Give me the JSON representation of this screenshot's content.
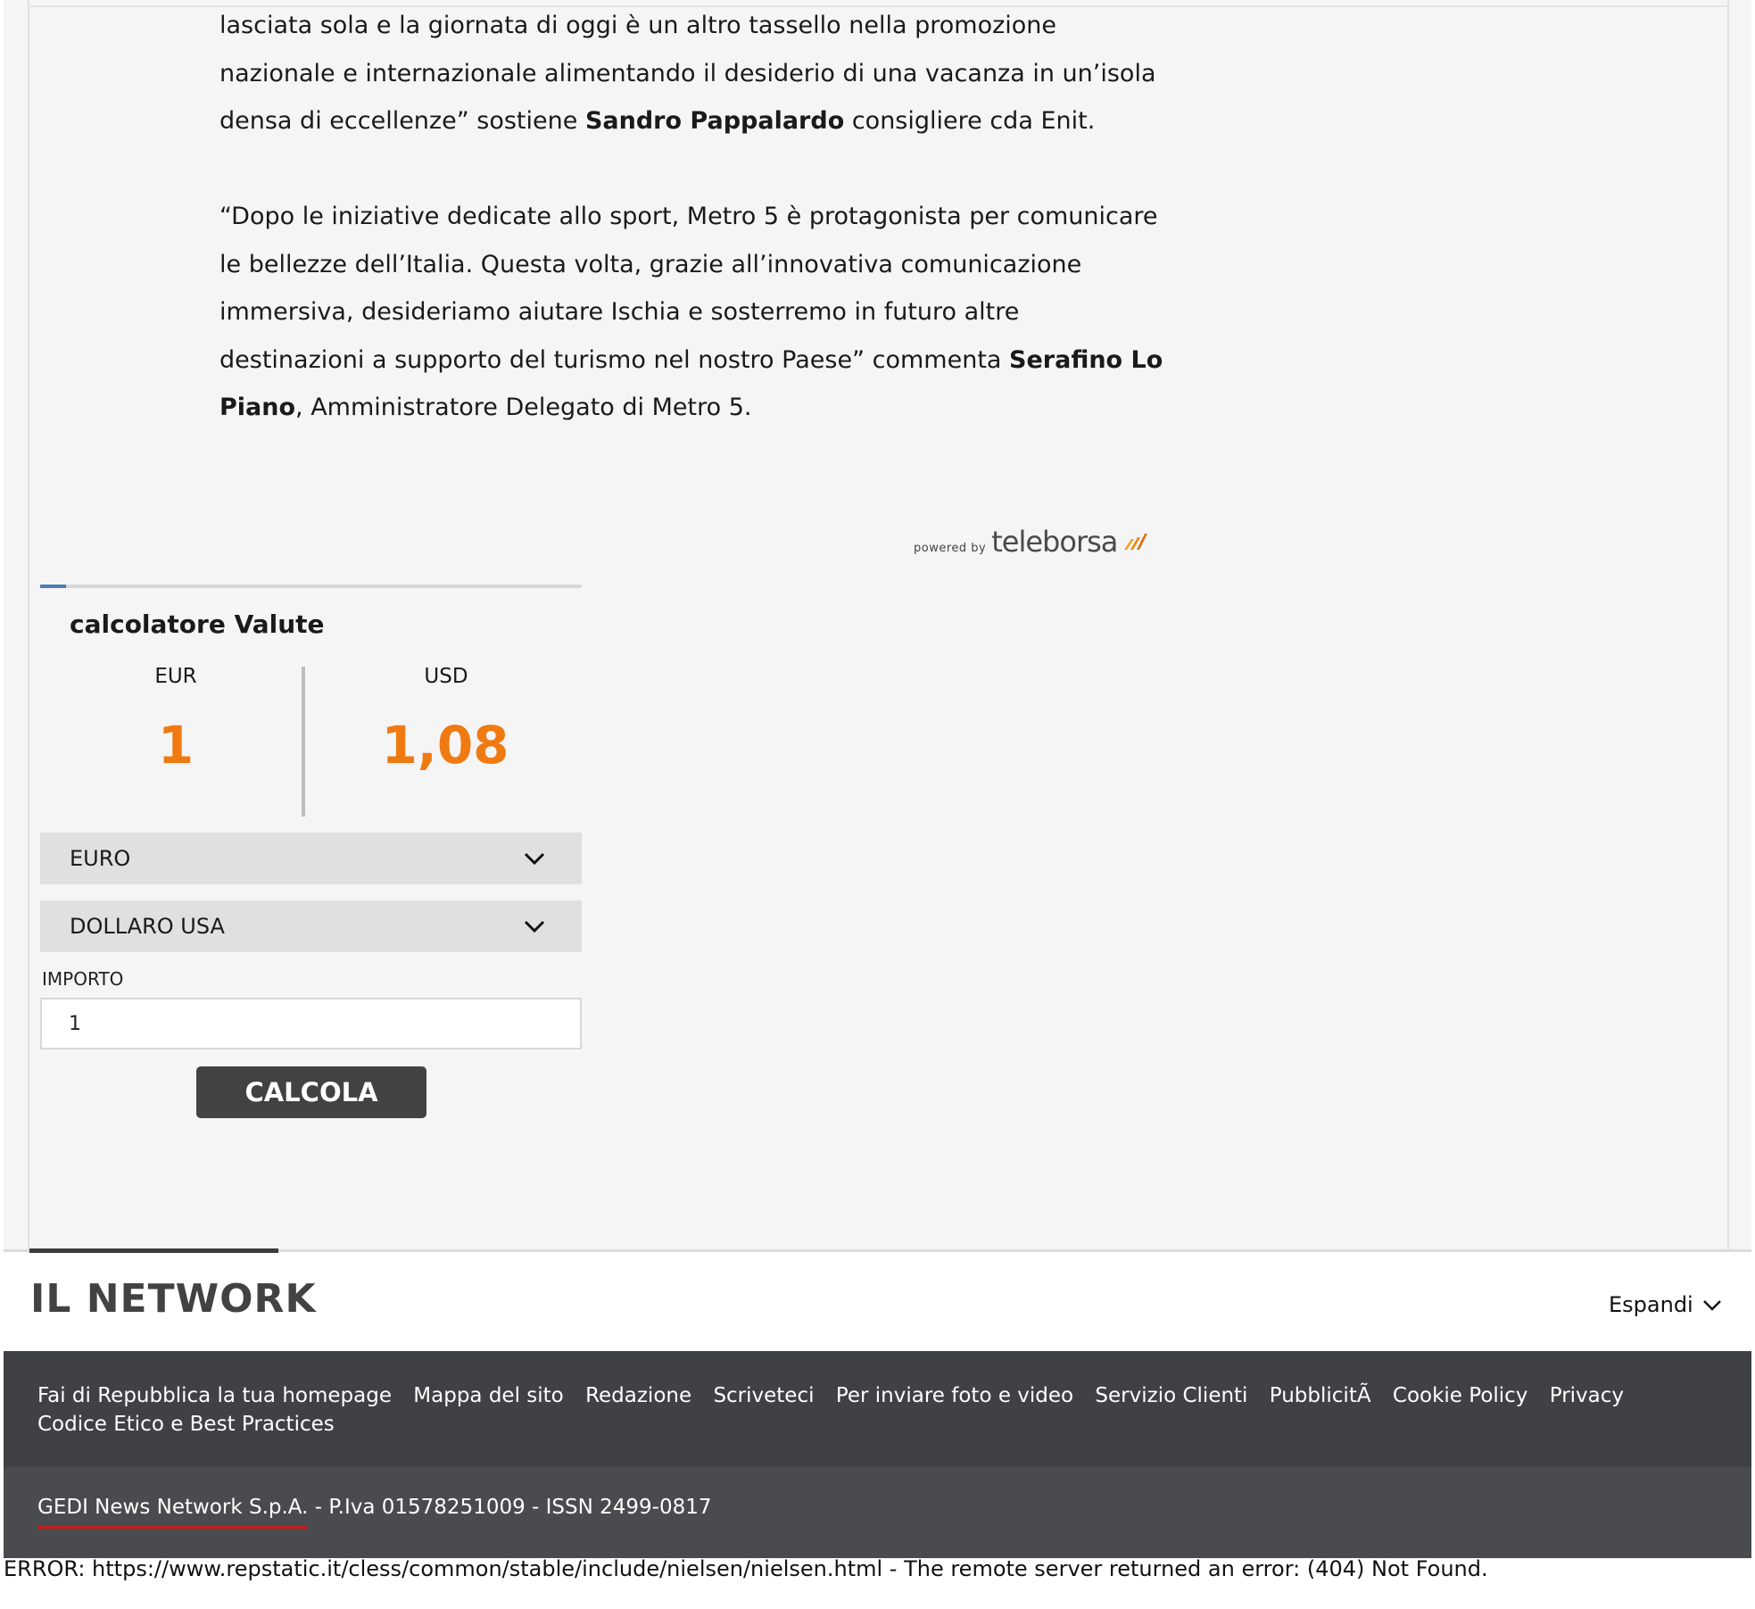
{
  "article": {
    "p1_text": "lasciata sola e la giornata di oggi è un altro tassello nella promozione nazionale e internazionale alimentando il desiderio di una vacanza in un’isola densa di eccellenze” sostiene ",
    "p1_name": "Sandro Pappalardo",
    "p1_end": " consigliere cda Enit.",
    "p2_text": "“Dopo le iniziative dedicate allo sport, Metro 5 è protagonista per comunicare le bellezze dell’Italia. Questa volta, grazie all’innovativa comunicazione immersiva, desideriamo aiutare Ischia e sosterremo in futuro altre destinazioni a supporto del turismo nel nostro Paese” commenta ",
    "p2_name": "Serafino Lo Piano",
    "p2_end": ", Amministratore Delegato di Metro 5."
  },
  "powered": {
    "small": "powered by",
    "brand": "teleborsa"
  },
  "calculator": {
    "title": "calcolatore Valute",
    "from_code": "EUR",
    "to_code": "USD",
    "from_value": "1",
    "to_value": "1,08",
    "from_currency": "EURO",
    "to_currency": "DOLLARO USA",
    "amount_label": "IMPORTO",
    "amount_value": "1",
    "button": "CALCOLA",
    "value_color": "#f07a12"
  },
  "network": {
    "title": "IL NETWORK",
    "expand": "Espandi"
  },
  "footer": {
    "links": [
      "Fai di Repubblica la tua homepage",
      "Mappa del sito",
      "Redazione",
      "Scriveteci",
      "Per inviare foto e video",
      "Servizio Clienti",
      "PubblicitÃ",
      "Cookie Policy",
      "Privacy",
      "Codice Etico e Best Practices"
    ],
    "company": "GEDI News Network S.p.A.",
    "legal": " - P.Iva 01578251009 - ISSN 2499-0817"
  },
  "error": "ERROR: https://www.repstatic.it/cless/common/stable/include/nielsen/nielsen.html - The remote server returned an error: (404) Not Found."
}
